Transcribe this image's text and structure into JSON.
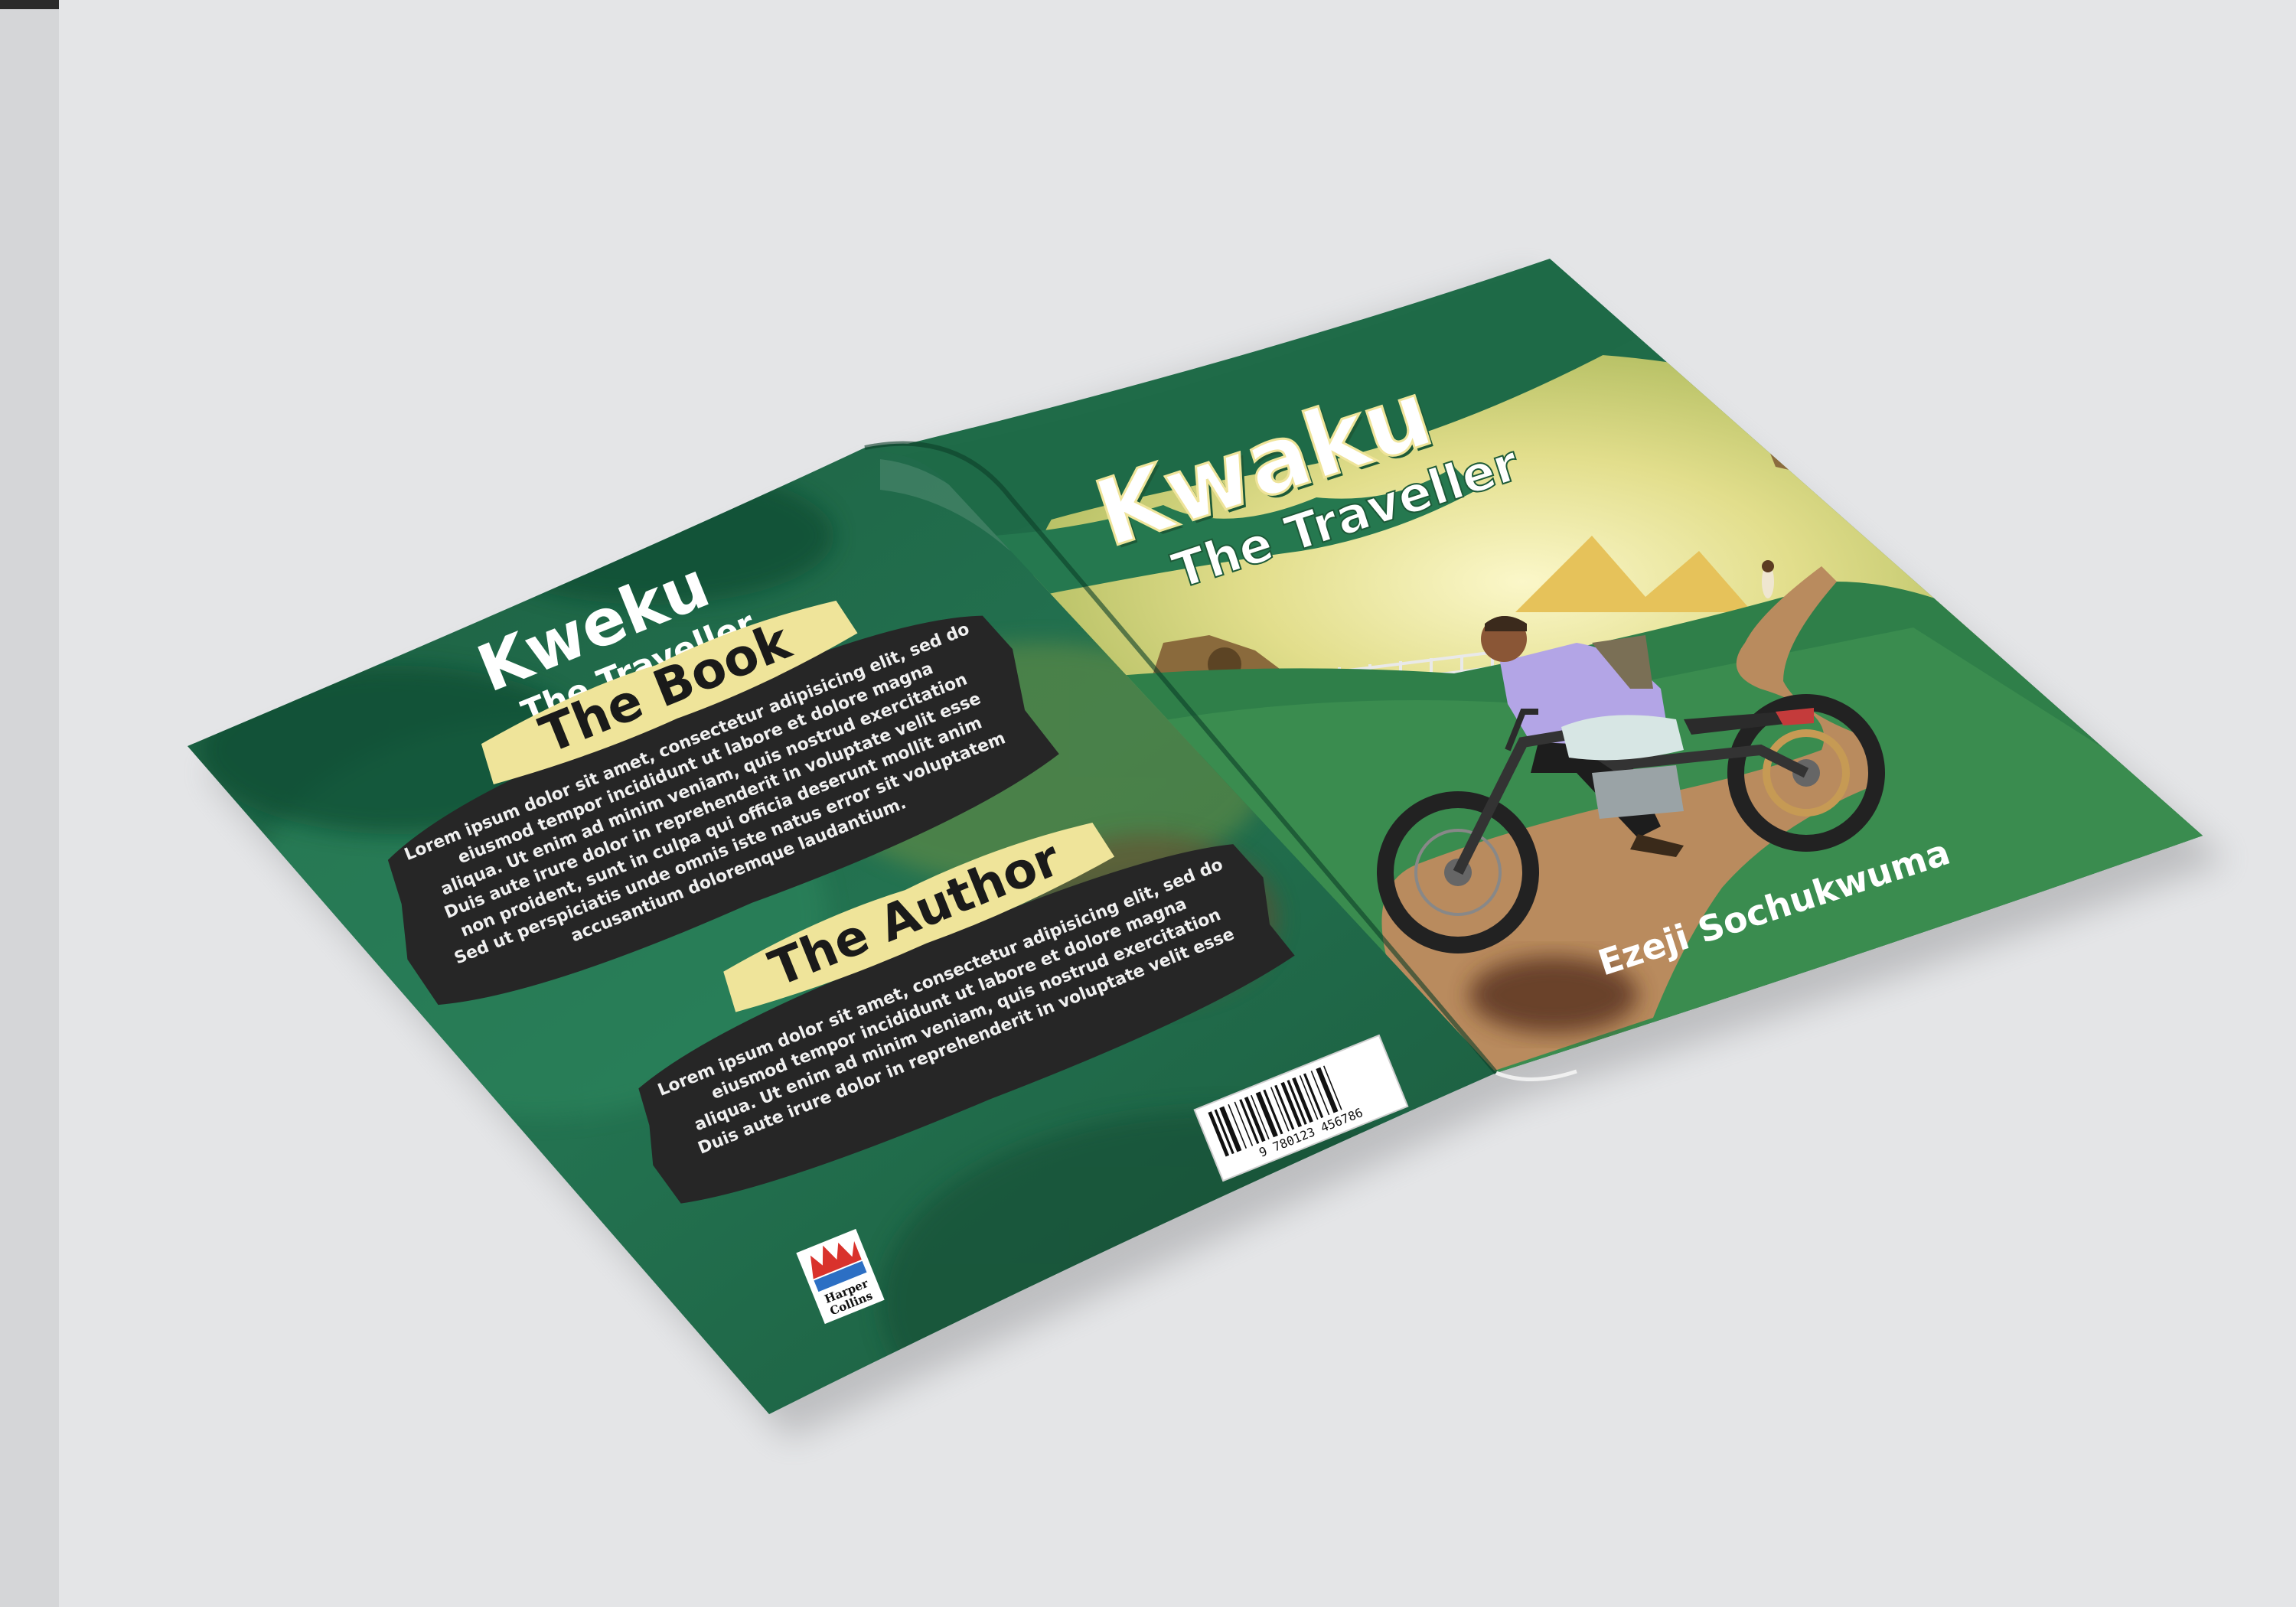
{
  "colors": {
    "background": "#e4e5e7",
    "cover_green": "#1f6b48",
    "cover_green_dark": "#0f4b32",
    "title_white": "#ffffff",
    "title_shadow": "#1d5a38",
    "banner_yellow": "#efe49a",
    "panel_black": "#262626",
    "path_brown": "#b88a5e",
    "shirt_lilac": "#b3a5e6"
  },
  "back_cover": {
    "title_main": "Kweku",
    "title_sub": "The Traveller",
    "book_heading": "The Book",
    "book_lines": [
      "Lorem ipsum dolor sit amet, consectetur adipisicing elit, sed do",
      "eiusmod tempor incididunt ut labore et dolore magna",
      "aliqua. Ut enim ad minim veniam, quis nostrud exercitation",
      "Duis aute irure dolor in reprehenderit in voluptate velit esse",
      "non proident, sunt in culpa qui officia deserunt mollit anim",
      "Sed ut perspiciatis unde omnis iste natus error sit voluptatem",
      "accusantium doloremque laudantium."
    ],
    "author_heading": "The Author",
    "author_lines": [
      "Lorem ipsum dolor sit amet, consectetur adipisicing elit, sed do",
      "eiusmod tempor incididunt ut labore et dolore magna",
      "aliqua. Ut enim ad minim veniam, quis nostrud exercitation",
      "Duis aute irure dolor in reprehenderit in voluptate velit esse"
    ],
    "barcode_digits": "9 780123 456786",
    "publisher_line1": "Harper",
    "publisher_line2": "Collins"
  },
  "front_cover": {
    "title_main": "Kwaku",
    "title_sub": "The Traveller",
    "author_name": "Ezeji Sochukwuma"
  }
}
